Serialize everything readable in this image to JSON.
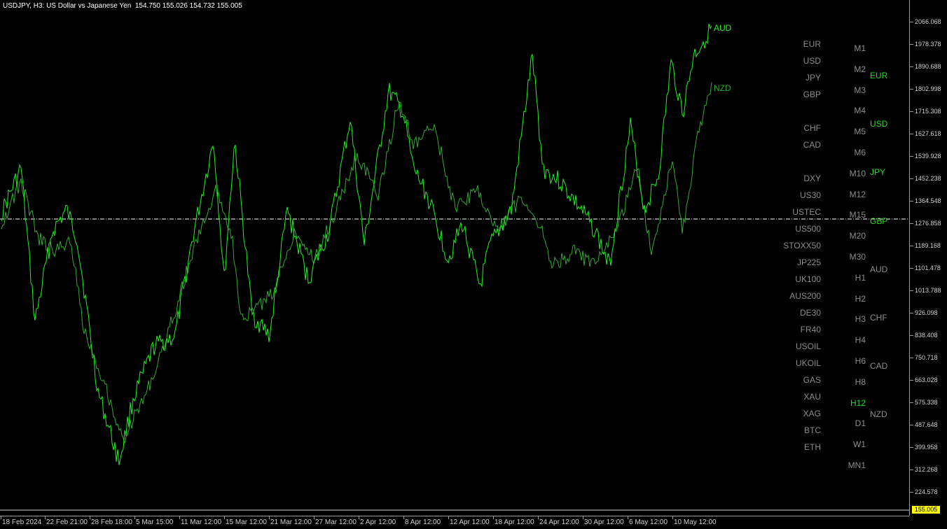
{
  "header": {
    "symbol": "USDJPY, H3:",
    "description": "US Dollar vs Japanese Yen",
    "ohlc": "154.750 155.026 154.732 155.005"
  },
  "price_axis": {
    "labels": [
      "2066.068",
      "1978.378",
      "1890.688",
      "1802.998",
      "1715.308",
      "1627.618",
      "1539.928",
      "1452.238",
      "1364.548",
      "1276.858",
      "1189.168",
      "1101.478",
      "1013.788",
      "926.098",
      "838.408",
      "750.718",
      "663.028",
      "575.338",
      "487.648",
      "399.958",
      "312.268",
      "224.578"
    ],
    "current_price": "155.005"
  },
  "time_axis": {
    "labels": [
      "18 Feb 2024",
      "22 Feb 21:00",
      "28 Feb 18:00",
      "5 Mar 15:00",
      "11 Mar 12:00",
      "15 Mar 12:00",
      "21 Mar 12:00",
      "27 Mar 12:00",
      "2 Apr 12:00",
      "8 Apr 12:00",
      "12 Apr 12:00",
      "18 Apr 12:00",
      "24 Apr 12:00",
      "30 Apr 12:00",
      "6 May 12:00",
      "10 May 12:00"
    ]
  },
  "series_labels": {
    "aud": "AUD",
    "nzd": "NZD"
  },
  "symbols": [
    "EUR",
    "USD",
    "JPY",
    "GBP",
    "",
    "CHF",
    "CAD",
    "",
    "DXY",
    "US30",
    "USTEC",
    "US500",
    "STOXX50",
    "JP225",
    "UK100",
    "AUS200",
    "DE30",
    "FR40",
    "USOIL",
    "UKOIL",
    "GAS",
    "XAU",
    "XAG",
    "BTC",
    "ETH"
  ],
  "timeframes": [
    "M1",
    "M2",
    "M3",
    "M4",
    "M5",
    "M6",
    "M10",
    "M12",
    "M15",
    "M20",
    "M30",
    "H1",
    "H2",
    "H3",
    "H4",
    "H6",
    "H8",
    "H12",
    "D1",
    "W1",
    "MN1"
  ],
  "active_timeframe": "H12",
  "currencies": [
    "EUR",
    "USD",
    "JPY",
    "GBP",
    "AUD",
    "CHF",
    "CAD",
    "NZD"
  ],
  "highlighted_currencies": [
    "EUR",
    "USD",
    "JPY",
    "GBP"
  ],
  "colors": {
    "aud_line": "#22ee22",
    "nzd_line": "#33a833",
    "accent_green": "#22dd22",
    "muted_text": "#8c8c8c",
    "dashed_line": "#ffffff",
    "price_marker": "#ffff00"
  }
}
